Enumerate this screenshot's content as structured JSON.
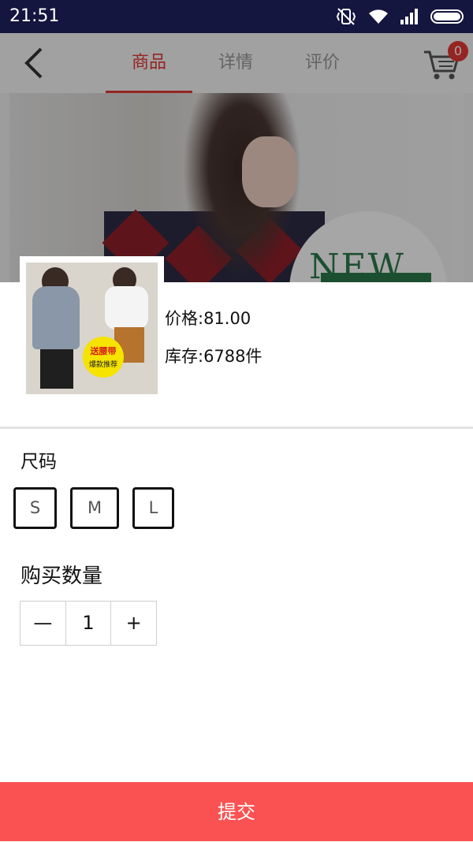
{
  "status_bar": {
    "time": "21:51"
  },
  "nav": {
    "tabs": [
      {
        "label": "商品"
      },
      {
        "label": "详情"
      },
      {
        "label": "评价"
      }
    ],
    "cart_count": "0"
  },
  "product": {
    "price": "价格:81.00",
    "stock": "库存:6788件",
    "thumb_badge_line1": "送腰带",
    "thumb_badge_line2": "爆款推荐"
  },
  "size": {
    "title": "尺码",
    "options": [
      "S",
      "M",
      "L"
    ]
  },
  "quantity": {
    "title": "购买数量",
    "minus": "—",
    "value": "1",
    "plus": "+"
  },
  "submit_label": "提交",
  "colors": {
    "accent": "#e53935",
    "submit_bg": "#fa5252",
    "status_bar": "#14163f"
  }
}
